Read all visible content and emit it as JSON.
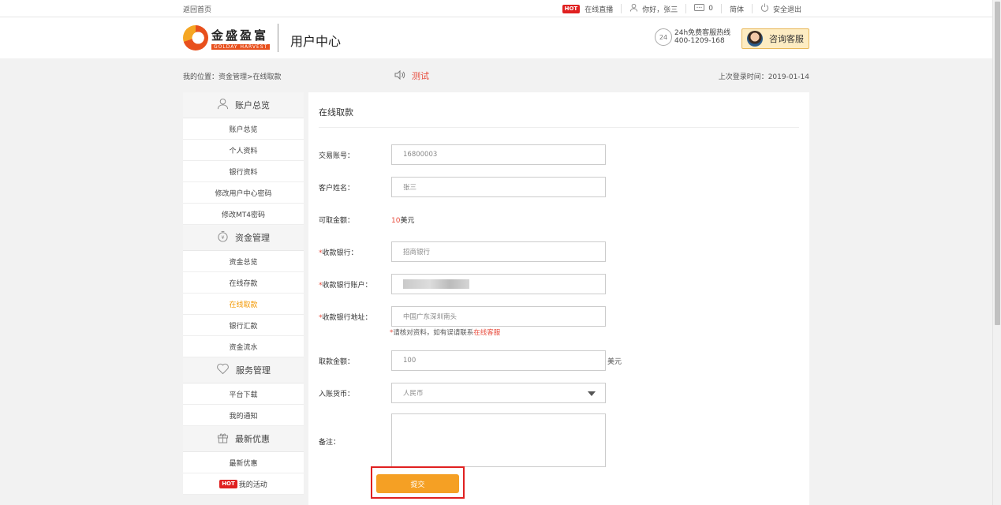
{
  "topbar": {
    "back_home": "返回首页",
    "hot_badge": "HOT",
    "live": "在线直播",
    "greeting": "你好，张三",
    "message_count": "0",
    "language": "简体",
    "logout": "安全退出"
  },
  "header": {
    "logo_cn": "金盛盈富",
    "logo_en": "GOLDAY HARVEST",
    "title": "用户中心",
    "hotline_icon_label": "24",
    "hotline_label": "24h免费客服热线",
    "hotline_number": "400-1209-168",
    "consult_label": "咨询客服"
  },
  "location": {
    "breadcrumb": "我的位置：资金管理>在线取款",
    "notice": "测试",
    "last_login": "上次登录时间：2019-01-14"
  },
  "sidebar": {
    "groups": [
      {
        "label": "账户总览",
        "icon": "user-icon",
        "items": [
          "账户总览",
          "个人资料",
          "银行资料",
          "修改用户中心密码",
          "修改MT4密码"
        ]
      },
      {
        "label": "资金管理",
        "icon": "money-icon",
        "items": [
          "资金总览",
          "在线存款",
          "在线取款",
          "银行汇款",
          "资金流水"
        ]
      },
      {
        "label": "服务管理",
        "icon": "heart-icon",
        "items": [
          "平台下载",
          "我的通知"
        ]
      },
      {
        "label": "最新优惠",
        "icon": "gift-icon",
        "items": [
          "最新优惠",
          "我的活动"
        ]
      }
    ],
    "active_item": "在线取款",
    "hot_badge": "HOT"
  },
  "form": {
    "title": "在线取款",
    "account_label": "交易账号：",
    "account_value": "16800003",
    "name_label": "客户姓名：",
    "name_value": "张三",
    "available_label": "可取金额：",
    "available_amount": "10",
    "available_unit": "美元",
    "req_mark": "*",
    "bank_label": "收款银行：",
    "bank_value": "招商银行",
    "bank_account_label": "收款银行账户：",
    "bank_address_label": "收款银行地址：",
    "bank_address_value": "中国广东深圳南头",
    "hint_text": "请核对资料，如有误请联系",
    "hint_link": "在线客服",
    "withdraw_label": "取款金额：",
    "withdraw_value": "100",
    "withdraw_unit": "美元",
    "currency_label": "入账货币：",
    "currency_value": "人民币",
    "remark_label": "备注：",
    "submit_label": "提交"
  },
  "colors": {
    "accent_orange": "#f5a024",
    "highlight_red": "#e02020",
    "active_text": "#f39800"
  }
}
